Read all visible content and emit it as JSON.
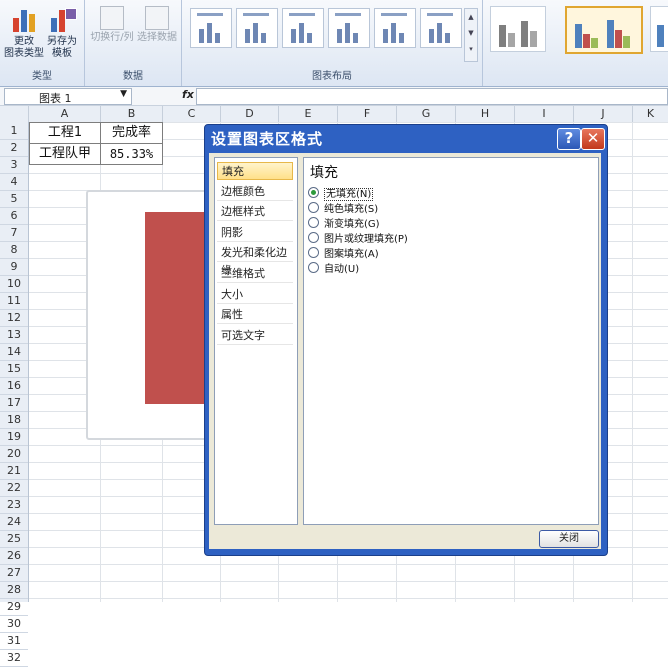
{
  "ribbon": {
    "type_group": {
      "label": "类型",
      "change_type": "更改\n图表类型",
      "save_template": "另存为\n模板"
    },
    "data_group": {
      "label": "数据",
      "switch_row_col": "切换行/列",
      "select_data": "选择数据"
    },
    "layout_group": {
      "label": "图表布局"
    }
  },
  "formula_bar": {
    "name_box": "图表 1",
    "fx": "fx",
    "value": ""
  },
  "columns": [
    "A",
    "B",
    "C",
    "D",
    "E",
    "F",
    "G",
    "H",
    "I",
    "J",
    "K"
  ],
  "rows": [
    "1",
    "2",
    "3",
    "4",
    "5",
    "6",
    "7",
    "8",
    "9",
    "10",
    "11",
    "12",
    "13",
    "14",
    "15",
    "16",
    "17",
    "18",
    "19",
    "20",
    "21",
    "22",
    "23",
    "24",
    "25",
    "26",
    "27",
    "28",
    "29",
    "30",
    "31",
    "32"
  ],
  "cells": {
    "a1": "工程1",
    "b1": "完成率",
    "a2": "工程队甲",
    "b2": "85.33%"
  },
  "chart": {
    "bar_color": "#c0504d",
    "bar_value_fraction": 0.8533
  },
  "dialog": {
    "title": "设置图表区格式",
    "help": "?",
    "close_x": "✕",
    "nav": [
      "填充",
      "边框颜色",
      "边框样式",
      "阴影",
      "发光和柔化边缘",
      "三维格式",
      "大小",
      "属性",
      "可选文字"
    ],
    "selected_nav": "填充",
    "section_title": "填充",
    "options": [
      {
        "label": "无填充(N)",
        "checked": true
      },
      {
        "label": "纯色填充(S)",
        "checked": false
      },
      {
        "label": "渐变填充(G)",
        "checked": false
      },
      {
        "label": "图片或纹理填充(P)",
        "checked": false
      },
      {
        "label": "图案填充(A)",
        "checked": false
      },
      {
        "label": "自动(U)",
        "checked": false
      }
    ],
    "close_button": "关闭"
  }
}
